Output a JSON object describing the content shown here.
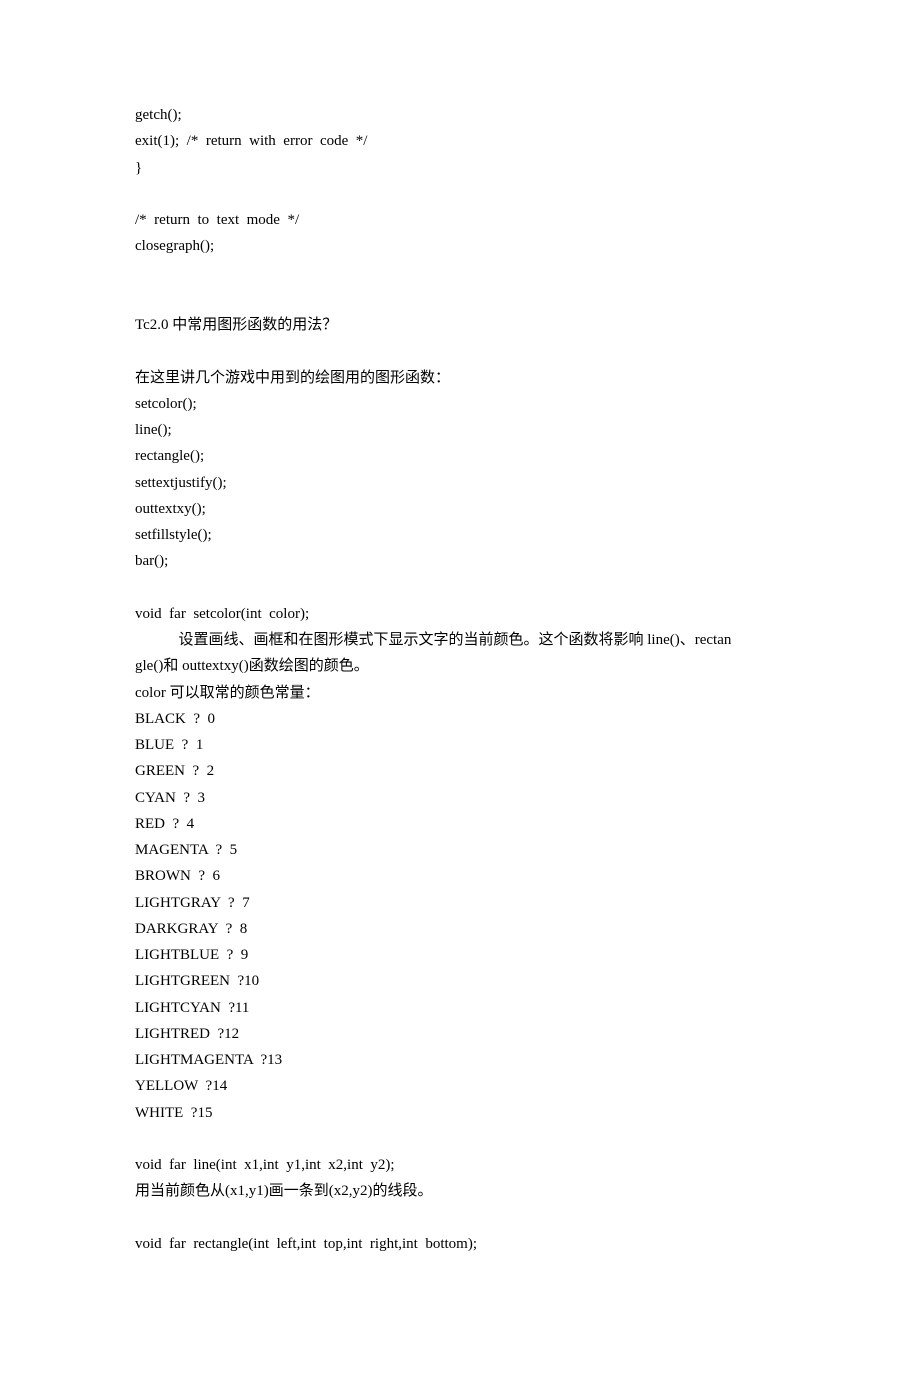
{
  "lines": [
    "getch();",
    "exit(1);  /*  return  with  error  code  */",
    "}",
    "",
    "/*  return  to  text  mode  */",
    "closegraph();",
    "",
    "",
    "Tc2.0 中常用图形函数的用法？",
    "",
    "在这里讲几个游戏中用到的绘图用的图形函数：",
    "setcolor();",
    "line();",
    "rectangle();",
    "settextjustify();",
    "outtextxy();",
    "setfillstyle();",
    "bar();",
    "",
    "void  far  setcolor(int  color);"
  ],
  "indent_line": "设置画线、画框和在图形模式下显示文字的当前颜色。这个函数将影响 line()、rectan",
  "lines2": [
    "gle()和 outtextxy()函数绘图的颜色。",
    "color 可以取常的颜色常量：",
    "BLACK  ?  0",
    "BLUE  ?  1",
    "GREEN  ?  2",
    "CYAN  ?  3",
    "RED  ?  4",
    "MAGENTA  ?  5",
    "BROWN  ?  6",
    "LIGHTGRAY  ?  7",
    "DARKGRAY  ?  8",
    "LIGHTBLUE  ?  9",
    "LIGHTGREEN  ?10",
    "LIGHTCYAN  ?11",
    "LIGHTRED  ?12",
    "LIGHTMAGENTA  ?13",
    "YELLOW  ?14",
    "WHITE  ?15",
    "",
    "void  far  line(int  x1,int  y1,int  x2,int  y2);",
    "用当前颜色从(x1,y1)画一条到(x2,y2)的线段。",
    "",
    "void  far  rectangle(int  left,int  top,int  right,int  bottom);"
  ]
}
